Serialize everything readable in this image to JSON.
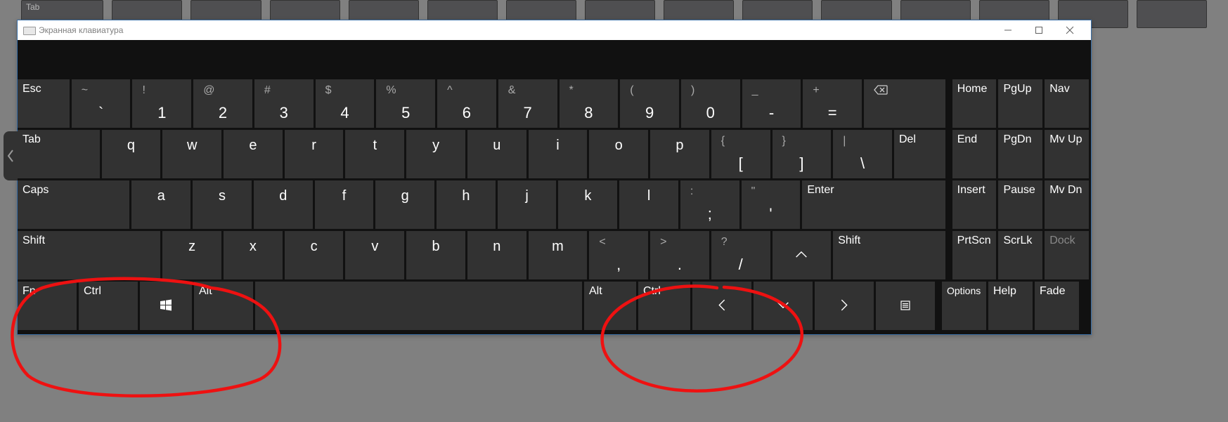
{
  "window": {
    "title": "Экранная клавиатура"
  },
  "row1": {
    "esc": "Esc",
    "keys": [
      {
        "sym": "~",
        "main": "`"
      },
      {
        "sym": "!",
        "main": "1"
      },
      {
        "sym": "@",
        "main": "2"
      },
      {
        "sym": "#",
        "main": "3"
      },
      {
        "sym": "$",
        "main": "4"
      },
      {
        "sym": "%",
        "main": "5"
      },
      {
        "sym": "^",
        "main": "6"
      },
      {
        "sym": "&",
        "main": "7"
      },
      {
        "sym": "*",
        "main": "8"
      },
      {
        "sym": "(",
        "main": "9"
      },
      {
        "sym": ")",
        "main": "0"
      },
      {
        "sym": "_",
        "main": "-"
      },
      {
        "sym": "+",
        "main": "="
      }
    ],
    "nav": [
      "Home",
      "PgUp",
      "Nav"
    ]
  },
  "row2": {
    "tab": "Tab",
    "letters": [
      "q",
      "w",
      "e",
      "r",
      "t",
      "y",
      "u",
      "i",
      "o",
      "p"
    ],
    "brackets": [
      {
        "sym": "{",
        "main": "["
      },
      {
        "sym": "}",
        "main": "]"
      },
      {
        "sym": "|",
        "main": "\\"
      }
    ],
    "del": "Del",
    "nav": [
      "End",
      "PgDn",
      "Mv Up"
    ]
  },
  "row3": {
    "caps": "Caps",
    "letters": [
      "a",
      "s",
      "d",
      "f",
      "g",
      "h",
      "j",
      "k",
      "l"
    ],
    "punct": [
      {
        "sym": ":",
        "main": ";"
      },
      {
        "sym": "\"",
        "main": "'"
      }
    ],
    "enter": "Enter",
    "nav": [
      "Insert",
      "Pause",
      "Mv Dn"
    ]
  },
  "row4": {
    "shift_l": "Shift",
    "letters": [
      "z",
      "x",
      "c",
      "v",
      "b",
      "n",
      "m"
    ],
    "punct": [
      {
        "sym": "<",
        "main": ","
      },
      {
        "sym": ">",
        "main": "."
      },
      {
        "sym": "?",
        "main": "/"
      }
    ],
    "shift_r": "Shift",
    "nav": [
      "PrtScn",
      "ScrLk",
      "Dock"
    ]
  },
  "row5": {
    "fn": "Fn",
    "ctrl_l": "Ctrl",
    "alt_l": "Alt",
    "alt_r": "Alt",
    "ctrl_r": "Ctrl",
    "options": "Options",
    "help": "Help",
    "fade": "Fade"
  }
}
